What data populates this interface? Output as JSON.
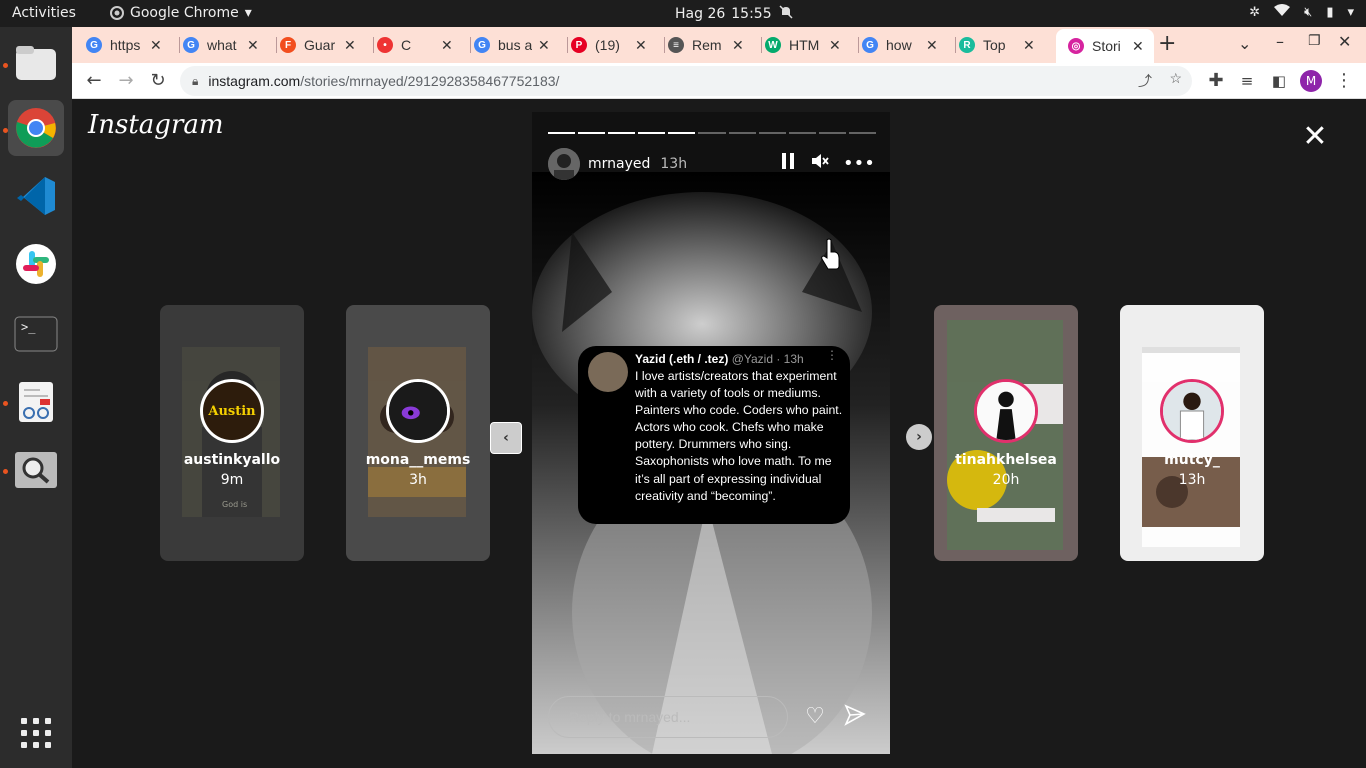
{
  "topbar": {
    "activities": "Activities",
    "app_name": "Google Chrome",
    "date": "Hag 26",
    "time": "15:55"
  },
  "dock": {
    "items": [
      {
        "name": "files-icon"
      },
      {
        "name": "chrome-icon"
      },
      {
        "name": "vscode-icon"
      },
      {
        "name": "slack-icon"
      },
      {
        "name": "terminal-icon"
      },
      {
        "name": "text-editor-icon"
      },
      {
        "name": "search-app-icon"
      },
      {
        "name": "show-apps-icon"
      }
    ]
  },
  "browser": {
    "tabs": [
      {
        "title": "https",
        "color": "#4285f4",
        "fav": "G"
      },
      {
        "title": "what",
        "color": "#4285f4",
        "fav": "G"
      },
      {
        "title": "Guar",
        "color": "#f24e1e",
        "fav": "F"
      },
      {
        "title": "C",
        "color": "#e33",
        "fav": "•"
      },
      {
        "title": "bus a",
        "color": "#4285f4",
        "fav": "G"
      },
      {
        "title": "(19)",
        "color": "#e60023",
        "fav": "P"
      },
      {
        "title": "Rem",
        "color": "#555",
        "fav": "≡"
      },
      {
        "title": "HTM",
        "color": "#04aa6d",
        "fav": "W"
      },
      {
        "title": "how",
        "color": "#4285f4",
        "fav": "G"
      },
      {
        "title": "Top",
        "color": "#1abc9c",
        "fav": "R"
      },
      {
        "title": "Stori",
        "color": "#d6249f",
        "fav": "◎"
      }
    ],
    "url_host": "instagram.com",
    "url_path": "/stories/mrnayed/2912928358467752183/",
    "profile_initial": "M"
  },
  "instagram": {
    "logo": "Instagram",
    "left_stories": [
      {
        "username": "austinkyallo",
        "age": "9m",
        "avatar_text": "Austin"
      },
      {
        "username": "mona__mems",
        "age": "3h"
      }
    ],
    "right_stories": [
      {
        "username": "tinahkhelsea",
        "age": "20h"
      },
      {
        "username": "mutcy_",
        "age": "13h"
      }
    ],
    "story": {
      "username": "mrnayed",
      "age": "13h",
      "progress_segments": 11,
      "progress_done": 5,
      "tweet": {
        "name": "Yazid (.eth / .tez)",
        "handle": "@Yazid · 13h",
        "text": "I love artists/creators that experiment with a variety of tools or mediums. Painters who code. Coders who paint. Actors who cook. Chefs who make pottery. Drummers who sing. Saxophonists who love math. To me it’s all part of expressing individual creativity and “becoming”."
      },
      "reply_placeholder": "Reply to mrnayed..."
    }
  }
}
